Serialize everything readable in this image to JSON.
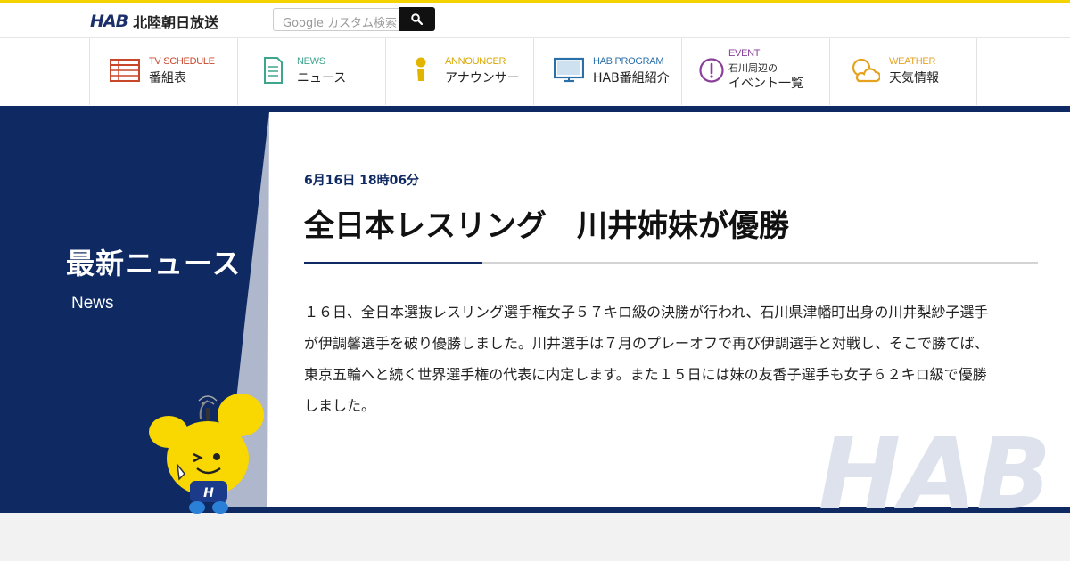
{
  "header": {
    "logo_mark": "HAB",
    "logo_name": "北陸朝日放送",
    "search": {
      "placeholder": "Google カスタム検索"
    }
  },
  "nav": {
    "items": [
      {
        "en": "TV SCHEDULE",
        "jp": "番組表",
        "icon": "tv-schedule-icon",
        "color": "#c8472a"
      },
      {
        "en": "NEWS",
        "jp": "ニュース",
        "icon": "news-icon",
        "color": "#3fa58d"
      },
      {
        "en": "ANNOUNCER",
        "jp": "アナウンサー",
        "icon": "announcer-icon",
        "color": "#d9a800"
      },
      {
        "en": "HAB PROGRAM",
        "jp": "HAB番組紹介",
        "icon": "monitor-icon",
        "color": "#2a6fa8"
      },
      {
        "en": "EVENT",
        "jp_small": "石川周辺の",
        "jp": "イベント一覧",
        "icon": "exclamation-icon",
        "color": "#8a3f9a"
      },
      {
        "en": "WEATHER",
        "jp": "天気情報",
        "icon": "weather-icon",
        "color": "#e6a21e"
      }
    ]
  },
  "section": {
    "title": "最新ニュース",
    "subtitle": "News"
  },
  "article": {
    "date": "6月16日 18時06分",
    "headline": "全日本レスリング　川井姉妹が優勝",
    "body": "１６日、全日本選抜レスリング選手権女子５７キロ級の決勝が行われ、石川県津幡町出身の川井梨紗子選手が伊調馨選手を破り優勝しました。川井選手は７月のプレーオフで再び伊調選手と対戦し、そこで勝てば、東京五輪へと続く世界選手権の代表に内定します。また１５日には妹の友香子選手も女子６２キロ級で優勝しました。"
  },
  "watermark_text": "HAB",
  "colors": {
    "navy": "#0f2a63",
    "accent_yellow": "#f5d300"
  }
}
